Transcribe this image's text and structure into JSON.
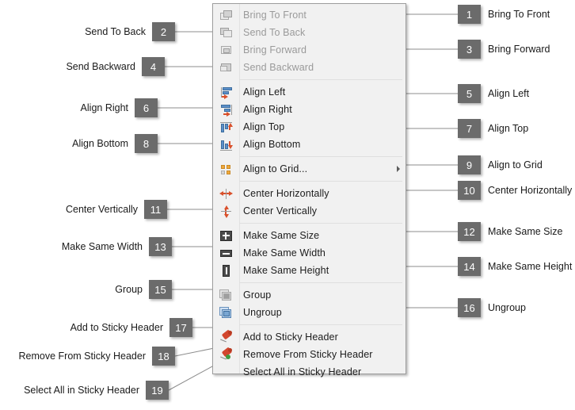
{
  "menu": {
    "name": "arrange-context-menu",
    "items": [
      {
        "id": "bring-to-front",
        "label": "Bring To Front",
        "icon": "bring-to-front-icon",
        "disabled": true,
        "separator_after": false,
        "submenu": false
      },
      {
        "id": "send-to-back",
        "label": "Send To Back",
        "icon": "send-to-back-icon",
        "disabled": true,
        "separator_after": false,
        "submenu": false
      },
      {
        "id": "bring-forward",
        "label": "Bring Forward",
        "icon": "bring-forward-icon",
        "disabled": true,
        "separator_after": false,
        "submenu": false
      },
      {
        "id": "send-backward",
        "label": "Send Backward",
        "icon": "send-backward-icon",
        "disabled": true,
        "separator_after": true,
        "submenu": false
      },
      {
        "id": "align-left",
        "label": "Align Left",
        "icon": "align-left-icon",
        "disabled": false,
        "separator_after": false,
        "submenu": false
      },
      {
        "id": "align-right",
        "label": "Align Right",
        "icon": "align-right-icon",
        "disabled": false,
        "separator_after": false,
        "submenu": false
      },
      {
        "id": "align-top",
        "label": "Align Top",
        "icon": "align-top-icon",
        "disabled": false,
        "separator_after": false,
        "submenu": false
      },
      {
        "id": "align-bottom",
        "label": "Align Bottom",
        "icon": "align-bottom-icon",
        "disabled": false,
        "separator_after": true,
        "submenu": false
      },
      {
        "id": "align-to-grid",
        "label": "Align to Grid...",
        "icon": "align-to-grid-icon",
        "disabled": false,
        "separator_after": true,
        "submenu": true
      },
      {
        "id": "center-horizontally",
        "label": "Center Horizontally",
        "icon": "center-horizontally-icon",
        "disabled": false,
        "separator_after": false,
        "submenu": false
      },
      {
        "id": "center-vertically",
        "label": "Center Vertically",
        "icon": "center-vertically-icon",
        "disabled": false,
        "separator_after": true,
        "submenu": false
      },
      {
        "id": "make-same-size",
        "label": "Make Same Size",
        "icon": "make-same-size-icon",
        "disabled": false,
        "separator_after": false,
        "submenu": false
      },
      {
        "id": "make-same-width",
        "label": "Make Same Width",
        "icon": "make-same-width-icon",
        "disabled": false,
        "separator_after": false,
        "submenu": false
      },
      {
        "id": "make-same-height",
        "label": "Make Same Height",
        "icon": "make-same-height-icon",
        "disabled": false,
        "separator_after": true,
        "submenu": false
      },
      {
        "id": "group",
        "label": "Group",
        "icon": "group-icon",
        "disabled": false,
        "separator_after": false,
        "submenu": false
      },
      {
        "id": "ungroup",
        "label": "Ungroup",
        "icon": "ungroup-icon",
        "disabled": false,
        "separator_after": true,
        "submenu": false
      },
      {
        "id": "add-to-sticky-header",
        "label": "Add to Sticky Header",
        "icon": "pin-add-icon",
        "disabled": false,
        "separator_after": false,
        "submenu": false
      },
      {
        "id": "remove-from-sticky-header",
        "label": "Remove From Sticky Header",
        "icon": "pin-remove-icon",
        "disabled": false,
        "separator_after": false,
        "submenu": false
      },
      {
        "id": "select-all-in-sticky-header",
        "label": "Select All in Sticky Header",
        "icon": "none",
        "disabled": false,
        "separator_after": false,
        "submenu": false
      }
    ]
  },
  "callouts": {
    "left": [
      {
        "number": "2",
        "label": "Send To Back"
      },
      {
        "number": "4",
        "label": "Send Backward"
      },
      {
        "number": "6",
        "label": "Align Right"
      },
      {
        "number": "8",
        "label": "Align Bottom"
      },
      {
        "number": "11",
        "label": "Center Vertically"
      },
      {
        "number": "13",
        "label": "Make Same Width"
      },
      {
        "number": "15",
        "label": "Group"
      },
      {
        "number": "17",
        "label": "Add to Sticky Header"
      },
      {
        "number": "18",
        "label": "Remove From Sticky Header"
      },
      {
        "number": "19",
        "label": "Select All in Sticky Header"
      }
    ],
    "right": [
      {
        "number": "1",
        "label": "Bring To Front"
      },
      {
        "number": "3",
        "label": "Bring Forward"
      },
      {
        "number": "5",
        "label": "Align Left"
      },
      {
        "number": "7",
        "label": "Align Top"
      },
      {
        "number": "9",
        "label": "Align to Grid"
      },
      {
        "number": "10",
        "label": "Center Horizontally"
      },
      {
        "number": "12",
        "label": "Make Same Size"
      },
      {
        "number": "14",
        "label": "Make Same Height"
      },
      {
        "number": "16",
        "label": "Ungroup"
      }
    ]
  },
  "colors": {
    "badge_bg": "#6b6b6b",
    "badge_text": "#ffffff",
    "menu_bg": "#f1f1f1",
    "menu_border": "#9d9d9d",
    "disabled_text": "#9a9a9a",
    "leader_line": "#8c8c8c",
    "accent_red": "#d9502b",
    "accent_blue": "#5b8fc9",
    "accent_orange": "#f0a93b"
  }
}
